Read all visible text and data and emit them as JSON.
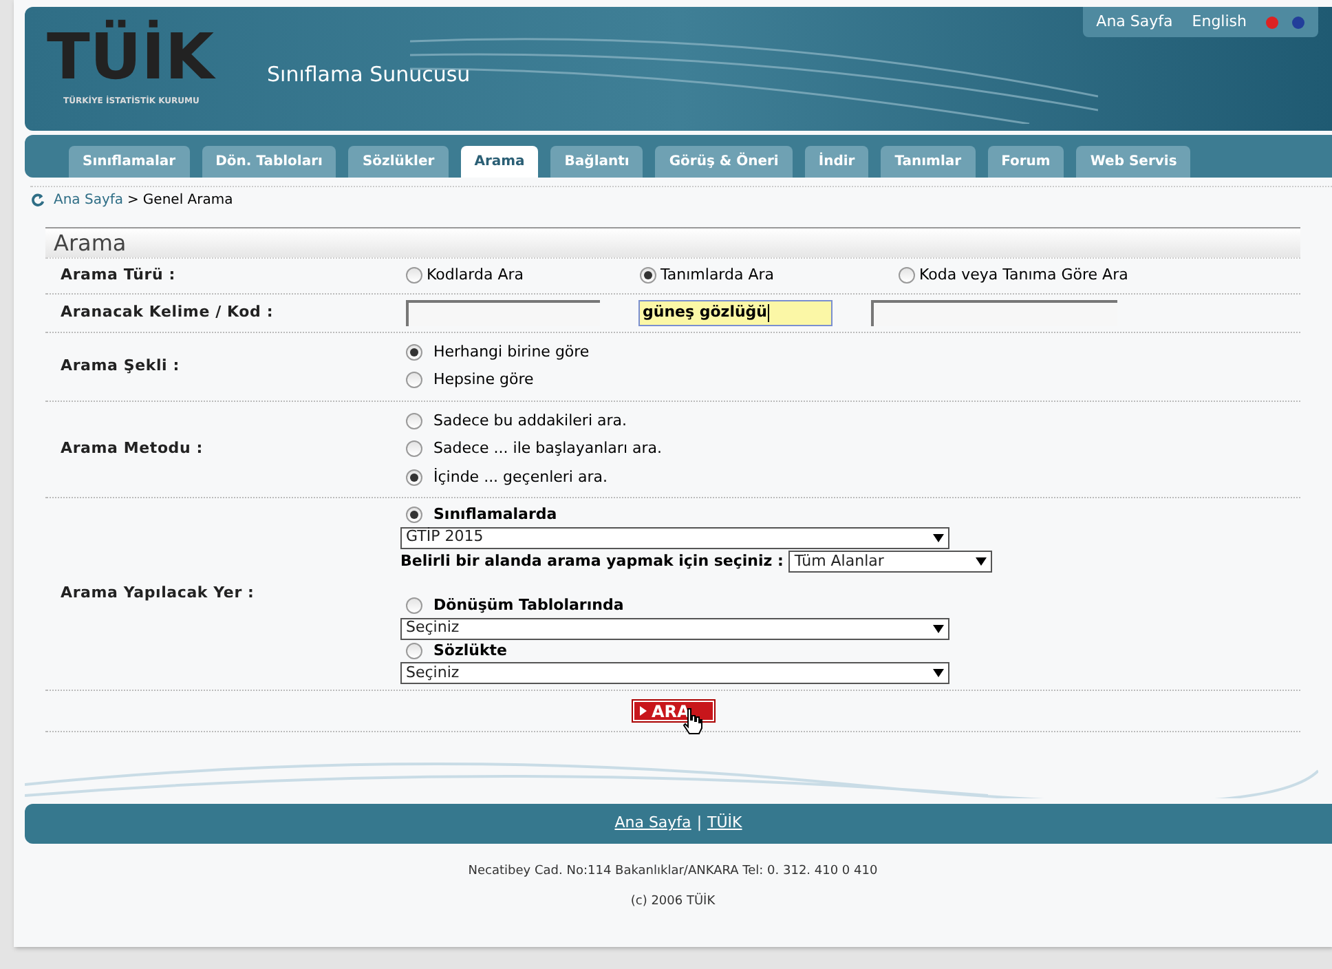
{
  "header": {
    "logo": "TÜİK",
    "logo_subtitle": "TÜRKİYE İSTATİSTİK KURUMU",
    "site_title": "Sınıflama Sunucusu",
    "top_links": [
      "Ana Sayfa",
      "English"
    ]
  },
  "tabs": [
    {
      "label": "Sınıflamalar",
      "selected": false
    },
    {
      "label": "Dön. Tabloları",
      "selected": false
    },
    {
      "label": "Sözlükler",
      "selected": false
    },
    {
      "label": "Arama",
      "selected": true
    },
    {
      "label": "Bağlantı",
      "selected": false
    },
    {
      "label": "Görüş & Öneri",
      "selected": false
    },
    {
      "label": "İndir",
      "selected": false
    },
    {
      "label": "Tanımlar",
      "selected": false
    },
    {
      "label": "Forum",
      "selected": false
    },
    {
      "label": "Web Servis",
      "selected": false
    }
  ],
  "breadcrumb": {
    "link": "Ana Sayfa",
    "separator": ">",
    "current": "Genel Arama"
  },
  "form": {
    "title": "Arama",
    "rows": [
      {
        "kind": "radio-inline",
        "label": "Arama Türü :",
        "options": [
          {
            "label": "Kodlarda Ara",
            "selected": false
          },
          {
            "label": "Tanımlarda Ara",
            "selected": true
          },
          {
            "label": "Koda veya Tanıma Göre Ara",
            "selected": false
          }
        ]
      },
      {
        "kind": "inputs",
        "label": "Aranacak Kelime / Kod :",
        "inputs": [
          {
            "focused": false
          },
          {
            "value": "güneş gözlüğü",
            "focused": true
          },
          {
            "focused": false
          }
        ]
      },
      {
        "kind": "radio-stack",
        "label": "Arama Şekli :",
        "options": [
          {
            "label": "Herhangi birine göre",
            "selected": true
          },
          {
            "label": "Hepsine göre",
            "selected": false
          }
        ]
      },
      {
        "kind": "radio-stack",
        "label": "Arama Metodu :",
        "options": [
          {
            "label": "Sadece bu addakileri ara.",
            "selected": false
          },
          {
            "label": "Sadece ... ile başlayanları ara.",
            "selected": false
          },
          {
            "label": "İçinde ... geçenleri ara.",
            "selected": true
          }
        ]
      },
      {
        "kind": "places",
        "label": "Arama Yapılacak Yer :",
        "groups": [
          {
            "label": "Sınıflamalarda",
            "selected": true,
            "select": "GTİP 2015",
            "field": {
              "label": "Belirli bir alanda arama yapmak için seçiniz :",
              "select": "Tüm Alanlar"
            }
          },
          {
            "label": "Dönüşüm Tablolarında",
            "selected": false,
            "select": "Seçiniz"
          },
          {
            "label": "Sözlükte",
            "selected": false,
            "select": "Seçiniz"
          }
        ]
      }
    ],
    "submit": "ARA"
  },
  "footer": {
    "links": [
      "Ana Sayfa",
      "TÜİK"
    ],
    "separator": "|",
    "address": "Necatibey Cad. No:114 Bakanlıklar/ANKARA Tel: 0. 312. 410 0 410",
    "copyright": "(c) 2006 TÜİK"
  }
}
